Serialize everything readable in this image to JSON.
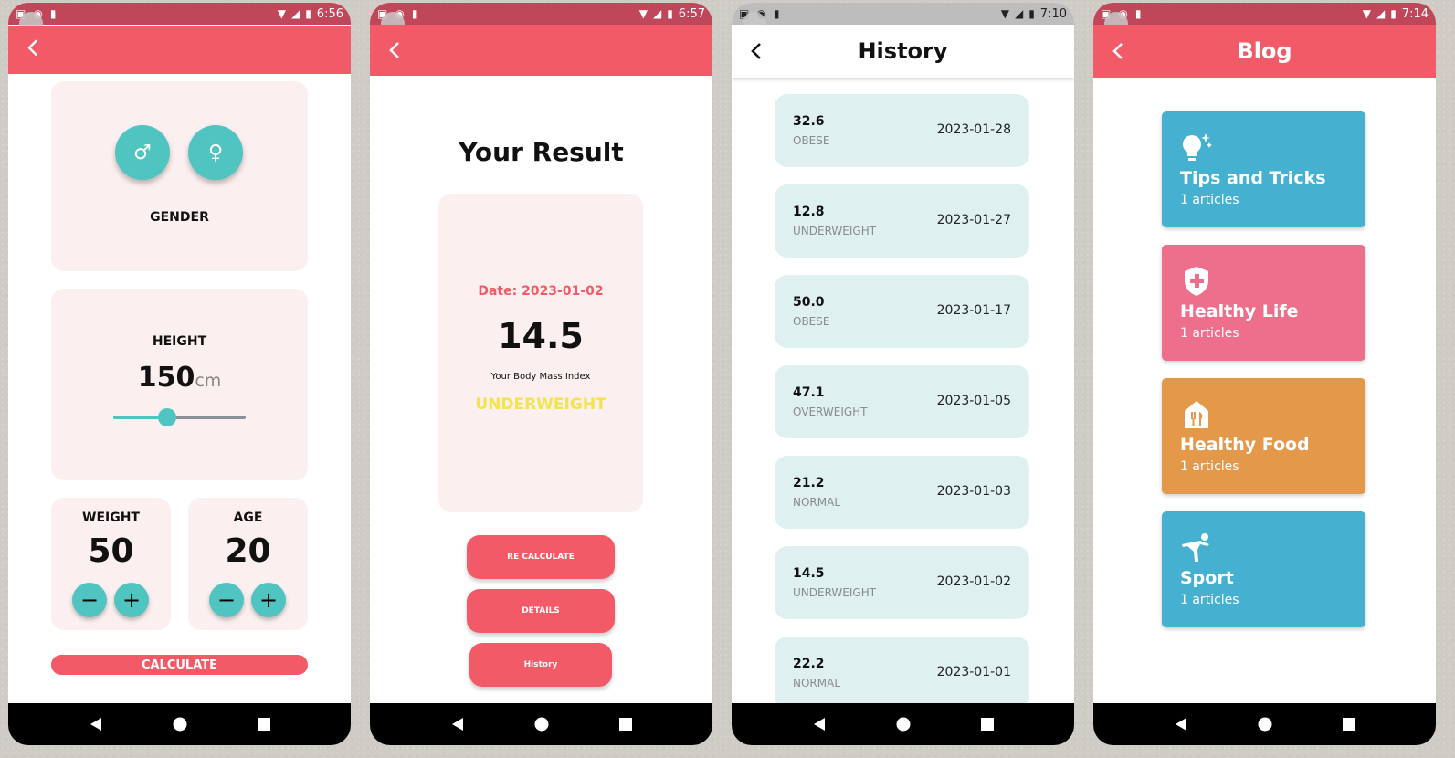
{
  "colors": {
    "accent": "#f25a67",
    "teal": "#4fc4c0",
    "card_bg": "#fcefef",
    "history_bg": "#dff0f1",
    "underweight": "#f2e44a"
  },
  "phone1": {
    "status": {
      "time": "6:56"
    },
    "gender": {
      "label": "GENDER",
      "male_icon": "male-symbol-icon",
      "female_icon": "female-symbol-icon"
    },
    "height": {
      "label": "HEIGHT",
      "value": "150",
      "unit": "cm",
      "slider_fraction": 0.41
    },
    "weight": {
      "label": "WEIGHT",
      "value": "50"
    },
    "age": {
      "label": "AGE",
      "value": "20"
    },
    "calculate_label": "CALCULATE"
  },
  "phone2": {
    "status": {
      "time": "6:57"
    },
    "title": "Your Result",
    "date": "Date: 2023-01-02",
    "bmi": "14.5",
    "bmi_caption": "Your Body Mass Index",
    "category": "UNDERWEIGHT",
    "buttons": {
      "recalculate": "RE CALCULATE",
      "details": "DETAILS",
      "history": "History"
    }
  },
  "phone3": {
    "status": {
      "time": "7:10"
    },
    "title": "History",
    "items": [
      {
        "bmi": "32.6",
        "category": "OBESE",
        "date": "2023-01-28"
      },
      {
        "bmi": "12.8",
        "category": "UNDERWEIGHT",
        "date": "2023-01-27"
      },
      {
        "bmi": "50.0",
        "category": "OBESE",
        "date": "2023-01-17"
      },
      {
        "bmi": "47.1",
        "category": "OVERWEIGHT",
        "date": "2023-01-05"
      },
      {
        "bmi": "21.2",
        "category": "NORMAL",
        "date": "2023-01-03"
      },
      {
        "bmi": "14.5",
        "category": "UNDERWEIGHT",
        "date": "2023-01-02"
      },
      {
        "bmi": "22.2",
        "category": "NORMAL",
        "date": "2023-01-01"
      }
    ]
  },
  "phone4": {
    "status": {
      "time": "7:14"
    },
    "title": "Blog",
    "cards": [
      {
        "title": "Tips and Tricks",
        "count": "1 articles",
        "color": "#45b0cf",
        "icon": "lightbulb-icon"
      },
      {
        "title": "Healthy Life",
        "count": "1 articles",
        "color": "#ee6f8c",
        "icon": "shield-plus-icon"
      },
      {
        "title": "Healthy Food",
        "count": "1 articles",
        "color": "#e4984a",
        "icon": "restaurant-icon"
      },
      {
        "title": "Sport",
        "count": "1 articles",
        "color": "#45b0cf",
        "icon": "sport-figure-icon"
      }
    ]
  }
}
